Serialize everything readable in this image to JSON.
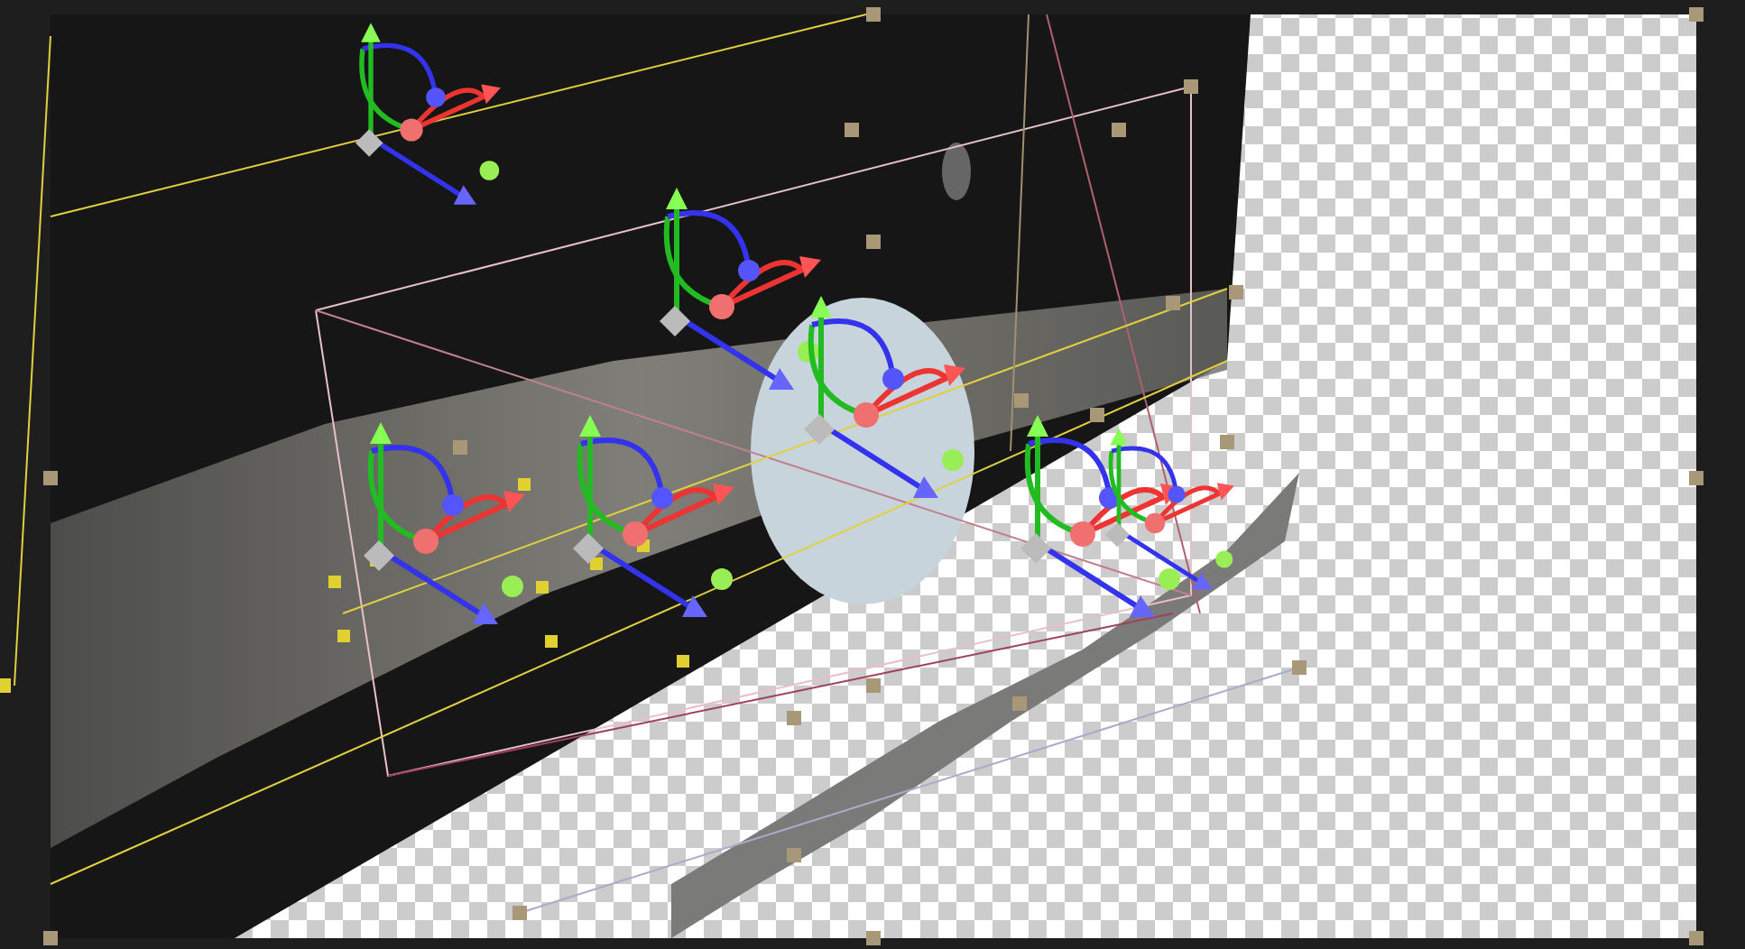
{
  "viewport": {
    "transparency_grid": true
  }
}
